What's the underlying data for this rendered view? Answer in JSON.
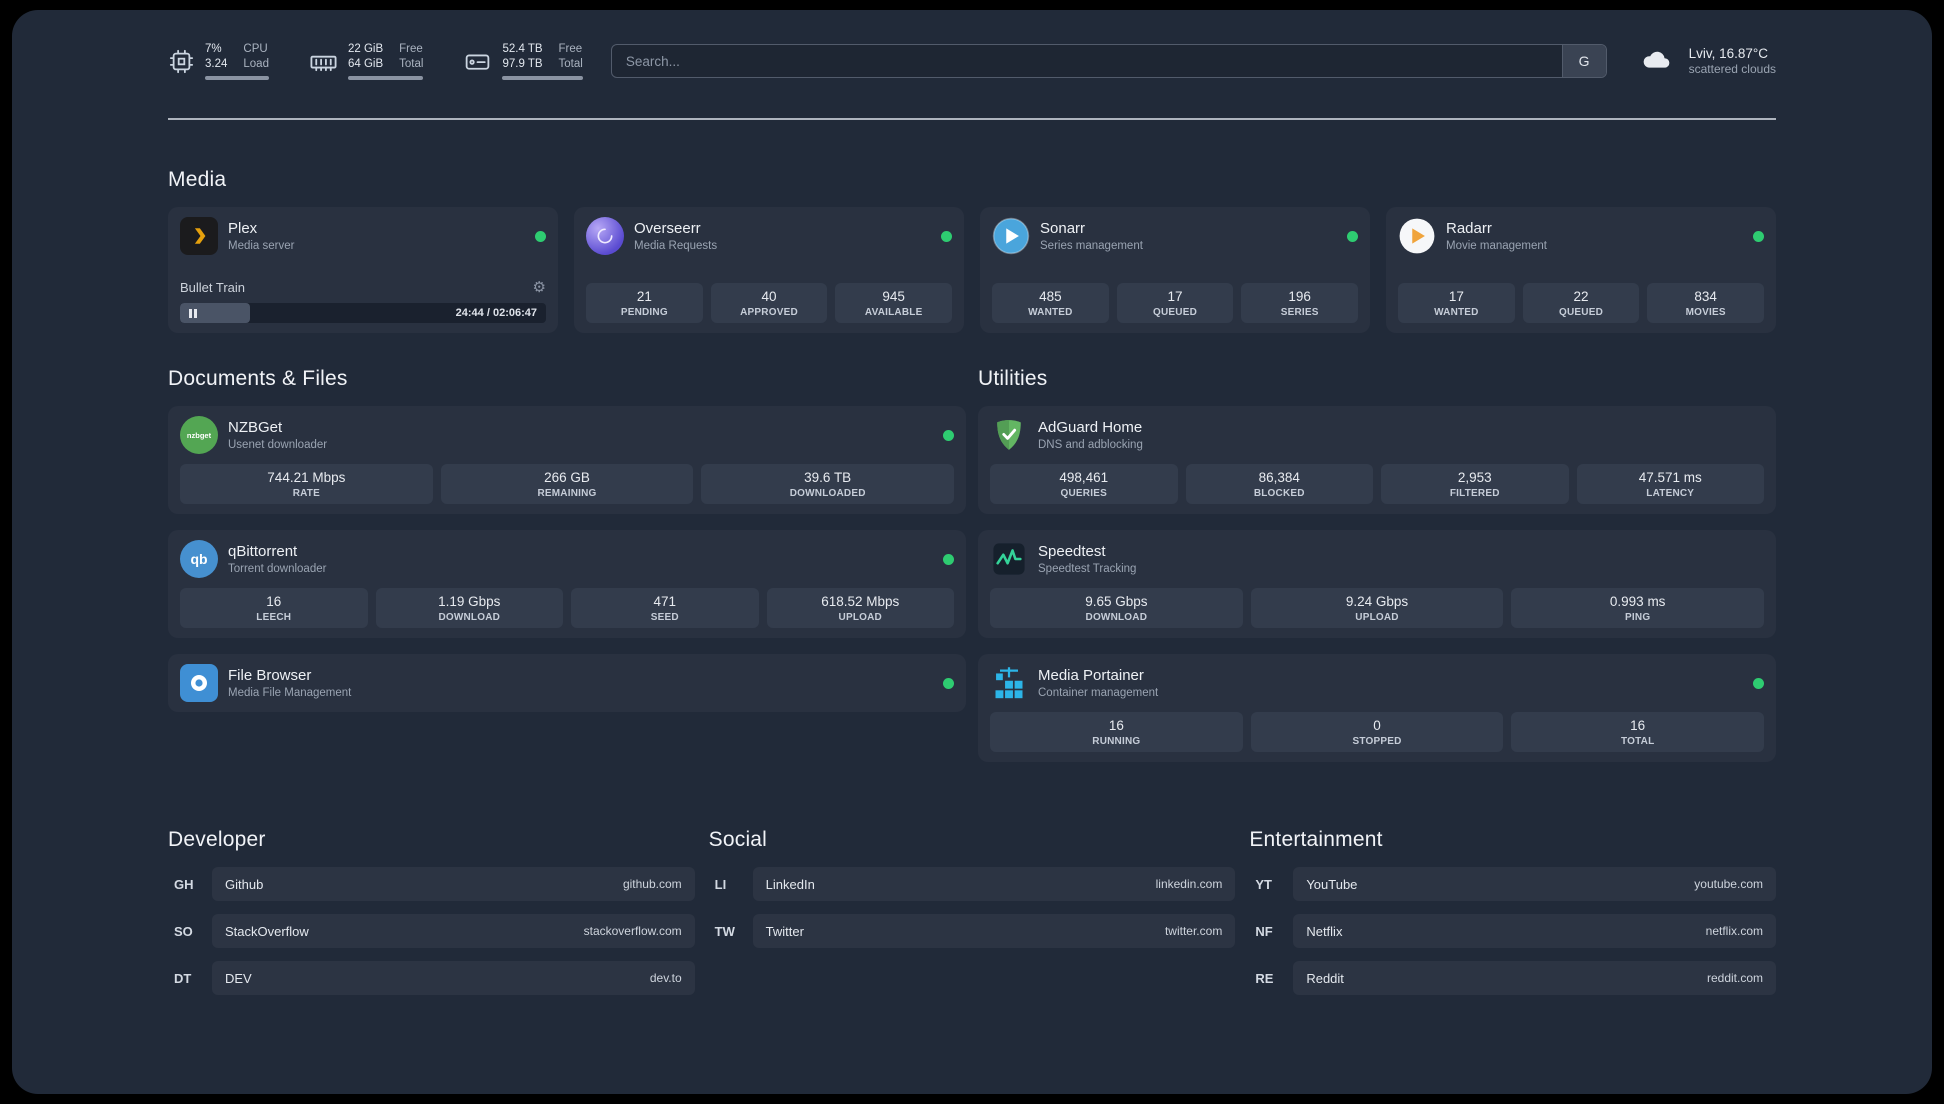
{
  "theme": {
    "page_bg": "#212a39",
    "card_bg": "#293140",
    "stat_bg": "#333c4c",
    "status_green": "#2ecc71",
    "plex_amber": "#e5a00d",
    "adguard_green": "#63b663",
    "portainer_blue": "#2cb5e8"
  },
  "topbar": {
    "cpu": {
      "value1": "7%",
      "label1": "CPU",
      "value2": "3.24",
      "label2": "Load"
    },
    "memory": {
      "value1": "22 GiB",
      "label1": "Free",
      "value2": "64 GiB",
      "label2": "Total"
    },
    "disk": {
      "value1": "52.4 TB",
      "label1": "Free",
      "value2": "97.9 TB",
      "label2": "Total"
    },
    "search": {
      "placeholder": "Search...",
      "provider_label": "G"
    },
    "weather": {
      "location": "Lviv, 16.87°C",
      "condition": "scattered clouds"
    }
  },
  "sections": {
    "media": {
      "title": "Media",
      "plex": {
        "name": "Plex",
        "desc": "Media server",
        "track": "Bullet Train",
        "time": "24:44 / 02:06:47"
      },
      "overseerr": {
        "name": "Overseerr",
        "desc": "Media Requests",
        "stats": [
          {
            "value": "21",
            "label": "PENDING"
          },
          {
            "value": "40",
            "label": "APPROVED"
          },
          {
            "value": "945",
            "label": "AVAILABLE"
          }
        ]
      },
      "sonarr": {
        "name": "Sonarr",
        "desc": "Series management",
        "stats": [
          {
            "value": "485",
            "label": "WANTED"
          },
          {
            "value": "17",
            "label": "QUEUED"
          },
          {
            "value": "196",
            "label": "SERIES"
          }
        ]
      },
      "radarr": {
        "name": "Radarr",
        "desc": "Movie management",
        "stats": [
          {
            "value": "17",
            "label": "WANTED"
          },
          {
            "value": "22",
            "label": "QUEUED"
          },
          {
            "value": "834",
            "label": "MOVIES"
          }
        ]
      }
    },
    "documents": {
      "title": "Documents & Files",
      "nzbget": {
        "name": "NZBGet",
        "desc": "Usenet downloader",
        "icon_text": "nzbget",
        "stats": [
          {
            "value": "744.21 Mbps",
            "label": "RATE"
          },
          {
            "value": "266 GB",
            "label": "REMAINING"
          },
          {
            "value": "39.6 TB",
            "label": "DOWNLOADED"
          }
        ]
      },
      "qbittorrent": {
        "name": "qBittorrent",
        "desc": "Torrent downloader",
        "icon_text": "qb",
        "stats": [
          {
            "value": "16",
            "label": "LEECH"
          },
          {
            "value": "1.19 Gbps",
            "label": "DOWNLOAD"
          },
          {
            "value": "471",
            "label": "SEED"
          },
          {
            "value": "618.52 Mbps",
            "label": "UPLOAD"
          }
        ]
      },
      "filebrowser": {
        "name": "File Browser",
        "desc": "Media File Management"
      }
    },
    "utilities": {
      "title": "Utilities",
      "adguard": {
        "name": "AdGuard Home",
        "desc": "DNS and adblocking",
        "stats": [
          {
            "value": "498,461",
            "label": "QUERIES"
          },
          {
            "value": "86,384",
            "label": "BLOCKED"
          },
          {
            "value": "2,953",
            "label": "FILTERED"
          },
          {
            "value": "47.571 ms",
            "label": "LATENCY"
          }
        ]
      },
      "speedtest": {
        "name": "Speedtest",
        "desc": "Speedtest Tracking",
        "stats": [
          {
            "value": "9.65 Gbps",
            "label": "DOWNLOAD"
          },
          {
            "value": "9.24 Gbps",
            "label": "UPLOAD"
          },
          {
            "value": "0.993 ms",
            "label": "PING"
          }
        ]
      },
      "portainer": {
        "name": "Media Portainer",
        "desc": "Container management",
        "stats": [
          {
            "value": "16",
            "label": "RUNNING"
          },
          {
            "value": "0",
            "label": "STOPPED"
          },
          {
            "value": "16",
            "label": "TOTAL"
          }
        ]
      }
    },
    "bookmarks": {
      "developer": {
        "title": "Developer",
        "items": [
          {
            "abbr": "GH",
            "name": "Github",
            "url": "github.com"
          },
          {
            "abbr": "SO",
            "name": "StackOverflow",
            "url": "stackoverflow.com"
          },
          {
            "abbr": "DT",
            "name": "DEV",
            "url": "dev.to"
          }
        ]
      },
      "social": {
        "title": "Social",
        "items": [
          {
            "abbr": "LI",
            "name": "LinkedIn",
            "url": "linkedin.com"
          },
          {
            "abbr": "TW",
            "name": "Twitter",
            "url": "twitter.com"
          }
        ]
      },
      "entertainment": {
        "title": "Entertainment",
        "items": [
          {
            "abbr": "YT",
            "name": "YouTube",
            "url": "youtube.com"
          },
          {
            "abbr": "NF",
            "name": "Netflix",
            "url": "netflix.com"
          },
          {
            "abbr": "RE",
            "name": "Reddit",
            "url": "reddit.com"
          }
        ]
      }
    }
  }
}
